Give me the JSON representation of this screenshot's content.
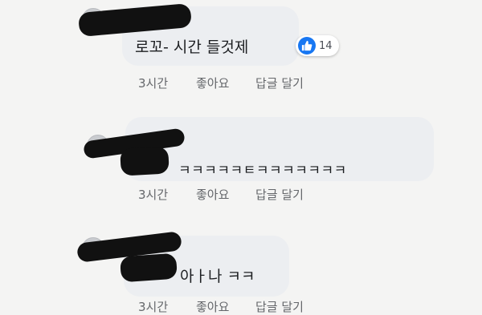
{
  "comments": [
    {
      "text": "로꼬- 시간 들것제",
      "reactions": {
        "icon": "thumbs-up-icon",
        "count": "14"
      },
      "time": "3시간",
      "like_label": "좋아요",
      "reply_label": "답글 달기"
    },
    {
      "text": "ㅋㅋㅋㅋㅋㅌㅋㅋㅋㅋㅋㅋㅋ",
      "time": "3시간",
      "like_label": "좋아요",
      "reply_label": "답글 달기"
    },
    {
      "text": "아ㅏ나 ㅋㅋ",
      "time": "3시간",
      "like_label": "좋아요",
      "reply_label": "답글 달기"
    }
  ],
  "colors": {
    "bubble": "#eceef1",
    "like_blue": "#1877f2",
    "meta_text": "#65676b"
  }
}
